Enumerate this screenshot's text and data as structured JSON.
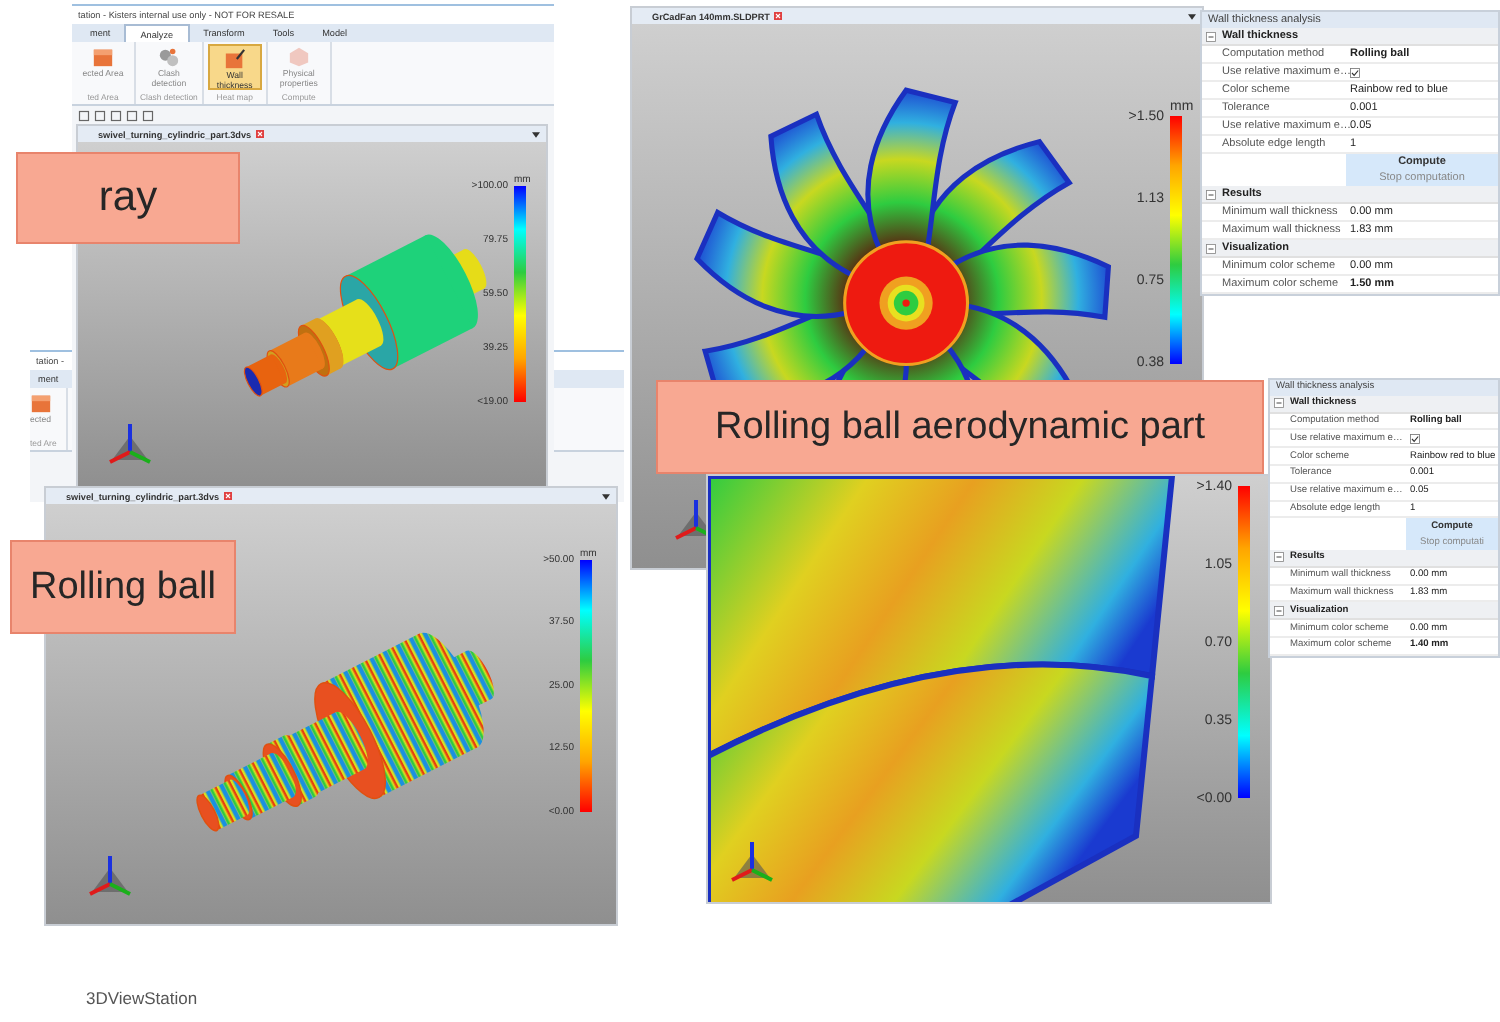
{
  "back_window": {
    "title": "tation -",
    "tabs": [
      {
        "label": "ment",
        "selected": false
      }
    ],
    "ribbon": [
      {
        "label": "ected",
        "selected": false
      }
    ],
    "groups": [
      "ted Are"
    ]
  },
  "front_window": {
    "title": "tation - Kisters internal use only - NOT FOR RESALE",
    "tabs": [
      {
        "label": "ment",
        "selected": false
      },
      {
        "label": "Analyze",
        "selected": true
      },
      {
        "label": "Transform",
        "selected": false
      },
      {
        "label": "Tools",
        "selected": false
      },
      {
        "label": "Model",
        "selected": false
      }
    ],
    "ribbon": [
      {
        "label": "ected Area",
        "selected": false
      },
      {
        "label": "Clash detection",
        "selected": false
      },
      {
        "label": "Wall thickness",
        "selected": true
      },
      {
        "label": "Physical properties",
        "selected": false
      }
    ],
    "groups": [
      "ted Area",
      "Clash detection",
      "Heat map",
      "Compute"
    ]
  },
  "viewports": [
    {
      "document_tab": "swivel_turning_cylindric_part.3dvs",
      "kind": "shaft_solid",
      "legend": {
        "unit": "mm",
        "ticks": [
          ">100.00",
          "79.75",
          "59.50",
          "39.25",
          "<19.00"
        ]
      }
    },
    {
      "document_tab": "swivel_turning_cylindric_part.3dvs",
      "kind": "shaft_banded",
      "legend": {
        "unit": "mm",
        "ticks": [
          ">50.00",
          "37.50",
          "25.00",
          "12.50",
          "<0.00"
        ]
      }
    },
    {
      "document_tab": "GrCadFan 140mm.SLDPRT",
      "kind": "fan",
      "legend": {
        "unit": "mm",
        "ticks": [
          ">1.50",
          "1.13",
          "0.75",
          "0.38"
        ]
      }
    },
    {
      "kind": "fan_closeup",
      "legend": {
        "ticks": [
          ">1.40",
          "1.05",
          "0.70",
          "0.35",
          "<0.00"
        ]
      }
    }
  ],
  "panels": [
    {
      "title": "Wall thickness analysis",
      "sections": [
        {
          "name": "Wall thickness",
          "expanded": true,
          "rows": [
            {
              "label": "Computation method",
              "kind": "bold",
              "value": "Rolling ball"
            },
            {
              "label": "Use relative maximum e…",
              "kind": "checkbox",
              "checked": true
            },
            {
              "label": "Color scheme",
              "kind": "text",
              "value": "Rainbow red to blue"
            },
            {
              "label": "Tolerance",
              "kind": "text",
              "value": "0.001"
            },
            {
              "label": "Use relative maximum e…",
              "kind": "text",
              "value": "0.05"
            },
            {
              "label": "Absolute edge length",
              "kind": "text",
              "value": "1"
            }
          ],
          "actions": [
            "Compute",
            "Stop computation"
          ]
        },
        {
          "name": "Results",
          "expanded": true,
          "rows": [
            {
              "label": "Minimum wall thickness",
              "kind": "text",
              "value": "0.00 mm"
            },
            {
              "label": "Maximum wall thickness",
              "kind": "text",
              "value": "1.83 mm"
            }
          ]
        },
        {
          "name": "Visualization",
          "expanded": true,
          "rows": [
            {
              "label": "Minimum color scheme",
              "kind": "text",
              "value": "0.00 mm"
            },
            {
              "label": "Maximum color scheme",
              "kind": "bold",
              "value": "1.50 mm"
            }
          ]
        }
      ]
    },
    {
      "title": "Wall thickness analysis",
      "sections": [
        {
          "name": "Wall thickness",
          "expanded": true,
          "rows": [
            {
              "label": "Computation method",
              "kind": "bold",
              "value": "Rolling ball"
            },
            {
              "label": "Use relative maximum e…",
              "kind": "checkbox",
              "checked": true
            },
            {
              "label": "Color scheme",
              "kind": "text",
              "value": "Rainbow red to blue"
            },
            {
              "label": "Tolerance",
              "kind": "text",
              "value": "0.001"
            },
            {
              "label": "Use relative maximum e…",
              "kind": "text",
              "value": "0.05"
            },
            {
              "label": "Absolute edge length",
              "kind": "text",
              "value": "1"
            }
          ],
          "actions": [
            "Compute",
            "Stop computati"
          ]
        },
        {
          "name": "Results",
          "expanded": true,
          "rows": [
            {
              "label": "Minimum wall thickness",
              "kind": "text",
              "value": "0.00 mm"
            },
            {
              "label": "Maximum wall thickness",
              "kind": "text",
              "value": "1.83 mm"
            }
          ]
        },
        {
          "name": "Visualization",
          "expanded": true,
          "rows": [
            {
              "label": "Minimum color scheme",
              "kind": "text",
              "value": "0.00 mm"
            },
            {
              "label": "Maximum color scheme",
              "kind": "bold",
              "value": "1.40 mm"
            }
          ]
        }
      ]
    }
  ],
  "callouts": [
    "ray",
    "Rolling ball",
    "Rolling ball aerodynamic part"
  ],
  "footer": "3DViewStation"
}
